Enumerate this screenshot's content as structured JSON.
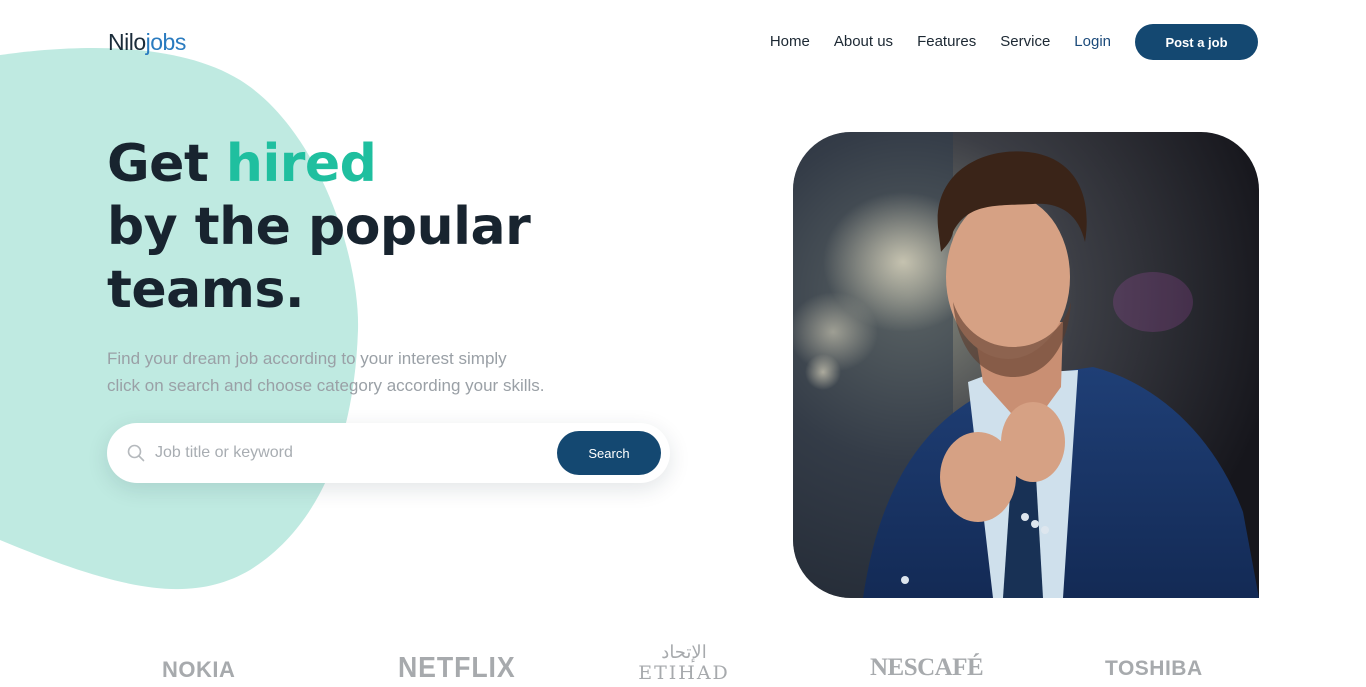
{
  "brand": {
    "name_part1": "Nilo",
    "name_part2": "jobs"
  },
  "nav": {
    "items": [
      {
        "label": "Home"
      },
      {
        "label": "About us"
      },
      {
        "label": "Features"
      },
      {
        "label": "Service"
      }
    ],
    "login_label": "Login",
    "post_job_label": "Post a job"
  },
  "hero": {
    "title_word1": "Get",
    "title_accent": "hired",
    "title_line2": "by the popular",
    "title_line3": "teams.",
    "subtitle_line1": "Find your dream job according to your interest simply",
    "subtitle_line2": "click on search and choose category according your skills."
  },
  "search": {
    "placeholder": "Job title or keyword",
    "button_label": "Search"
  },
  "partners": {
    "nokia": "NOKIA",
    "netflix": "NETFLIX",
    "etihad_arabic": "الإتحاد",
    "etihad": "ETIHAD",
    "nescafe": "NESCAFÉ",
    "toshiba": "TOSHIBA"
  },
  "colors": {
    "accent": "#1fbf9f",
    "primary": "#144871",
    "blob": "#bfeae1",
    "brand_gray": "#a7aaad"
  },
  "icons": {
    "search": "search-icon"
  }
}
